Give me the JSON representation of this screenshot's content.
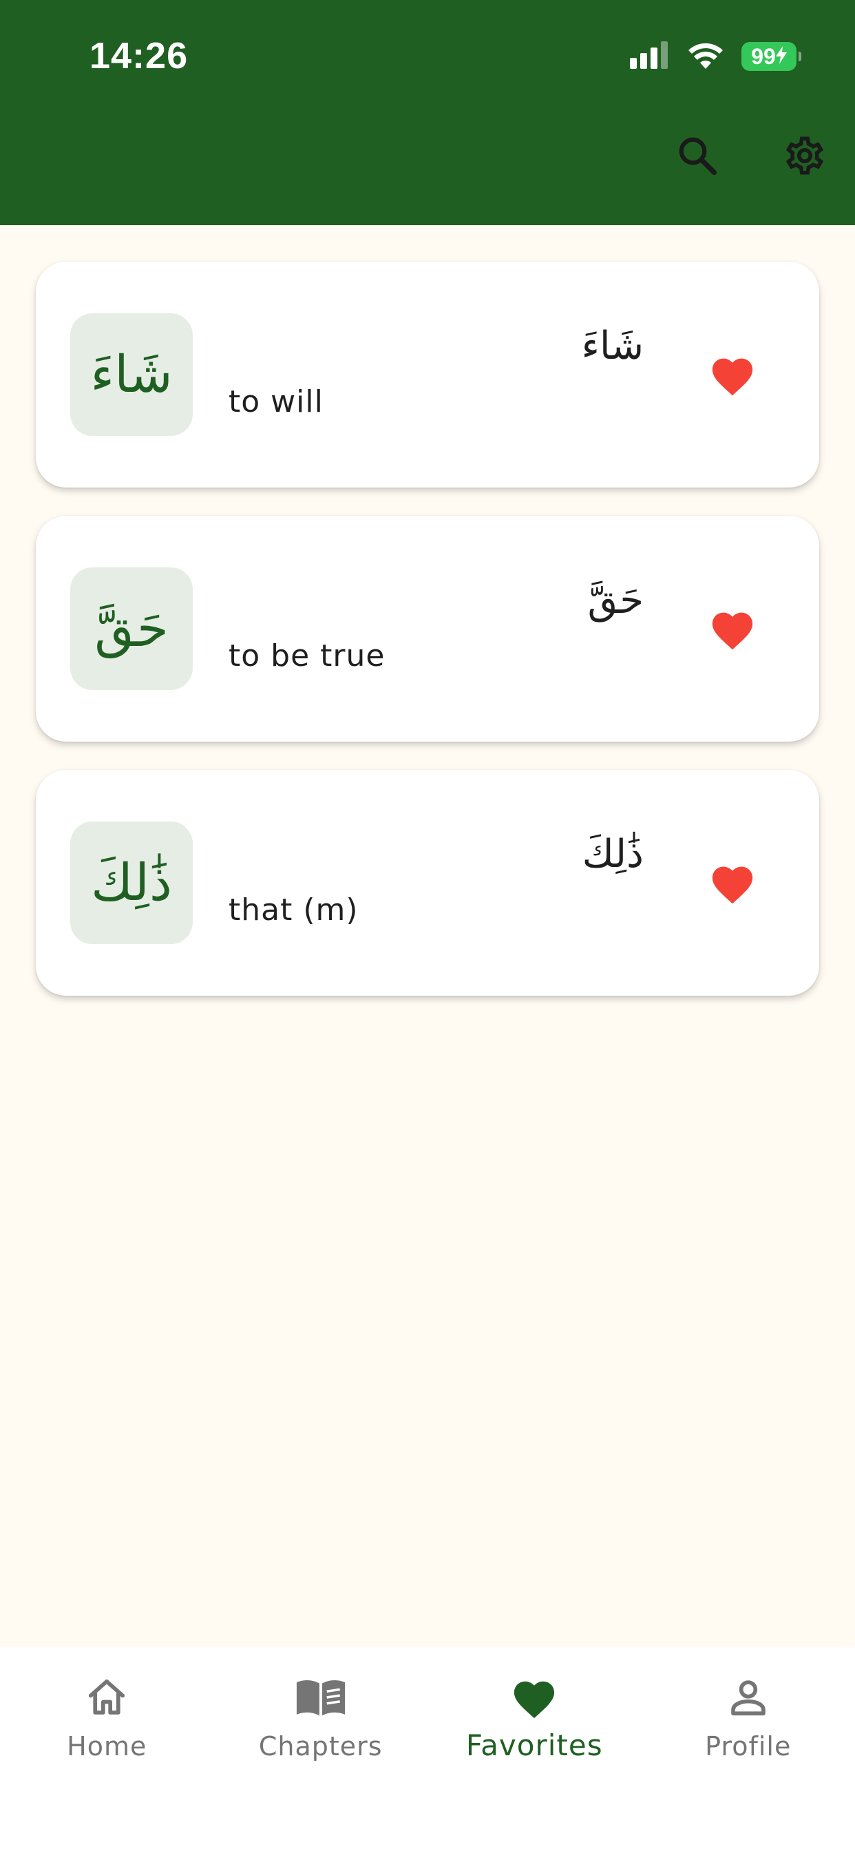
{
  "status_bar": {
    "time": "14:26",
    "battery": "99"
  },
  "header": {
    "actions": [
      {
        "icon": "search-icon"
      },
      {
        "icon": "gear-icon"
      }
    ]
  },
  "words": [
    {
      "badge": "شَاءَ",
      "arabic": "شَاءَ",
      "meaning": "to will",
      "favorite": true
    },
    {
      "badge": "حَقَّ",
      "arabic": "حَقَّ",
      "meaning": "to be true",
      "favorite": true
    },
    {
      "badge": "ذَٰلِكَ",
      "arabic": "ذَٰلِكَ",
      "meaning": "that (m)",
      "favorite": true
    }
  ],
  "bottom_nav": {
    "items": [
      {
        "label": "Home",
        "icon": "home-icon"
      },
      {
        "label": "Chapters",
        "icon": "book-icon"
      },
      {
        "label": "Favorites",
        "icon": "heart-icon",
        "active": true
      },
      {
        "label": "Profile",
        "icon": "person-icon"
      }
    ]
  },
  "colors": {
    "primary": "#1F5F22",
    "background": "#FFFBF3",
    "favorite": "#F44336",
    "badge_bg": "#E6EDE5",
    "battery": "#34C759"
  }
}
